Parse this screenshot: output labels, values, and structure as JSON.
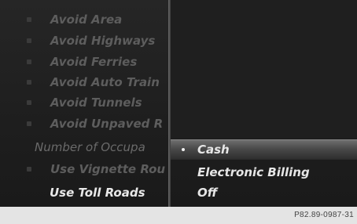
{
  "route_options": {
    "items": [
      {
        "label": "Avoid Area"
      },
      {
        "label": "Avoid Highways"
      },
      {
        "label": "Avoid Ferries"
      },
      {
        "label": "Avoid Auto Train"
      },
      {
        "label": "Avoid Tunnels"
      },
      {
        "label": "Avoid Unpaved R"
      },
      {
        "label": "Number of Occupa"
      },
      {
        "label": "Use Vignette Rou"
      },
      {
        "label": "Use Toll Roads"
      }
    ]
  },
  "toll_payment": {
    "options": [
      {
        "label": "Cash",
        "selected": true
      },
      {
        "label": "Electronic Billing",
        "selected": false
      },
      {
        "label": "Off",
        "selected": false
      }
    ]
  },
  "footer": {
    "reference": "P82.89-0987-31"
  }
}
